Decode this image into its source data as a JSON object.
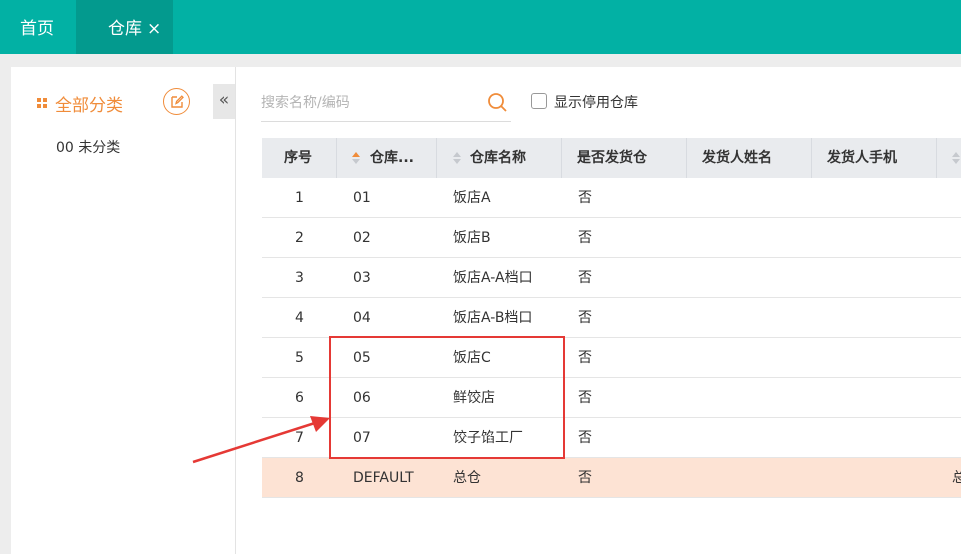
{
  "tabs": {
    "home": "首页",
    "warehouse": "仓库",
    "close_glyph": "×"
  },
  "categories": {
    "title": "全部分类",
    "items": [
      "00 未分类"
    ],
    "collapse_glyph": "«"
  },
  "search": {
    "placeholder": "搜索名称/编码",
    "value": ""
  },
  "filter": {
    "show_disabled_label": "显示停用仓库",
    "checked": false
  },
  "table": {
    "headers": [
      "序号",
      "仓库...",
      "仓库名称",
      "是否发货仓",
      "发货人姓名",
      "发货人手机"
    ],
    "rows": [
      {
        "idx": "1",
        "code": "01",
        "name": "饭店A",
        "ship": "否",
        "overflow": ""
      },
      {
        "idx": "2",
        "code": "02",
        "name": "饭店B",
        "ship": "否",
        "overflow": ""
      },
      {
        "idx": "3",
        "code": "03",
        "name": "饭店A-A档口",
        "ship": "否",
        "overflow": ""
      },
      {
        "idx": "4",
        "code": "04",
        "name": "饭店A-B档口",
        "ship": "否",
        "overflow": ""
      },
      {
        "idx": "5",
        "code": "05",
        "name": "饭店C",
        "ship": "否",
        "overflow": ""
      },
      {
        "idx": "6",
        "code": "06",
        "name": "鲜饺店",
        "ship": "否",
        "overflow": ""
      },
      {
        "idx": "7",
        "code": "07",
        "name": "饺子馅工厂",
        "ship": "否",
        "overflow": ""
      },
      {
        "idx": "8",
        "code": "DEFAULT",
        "name": "总仓",
        "ship": "否",
        "overflow": "总"
      }
    ]
  },
  "colors": {
    "brand": "#02b1a4",
    "accent": "#f08c3a",
    "highlight_row": "#fde3d4",
    "annotation": "#e53935"
  }
}
